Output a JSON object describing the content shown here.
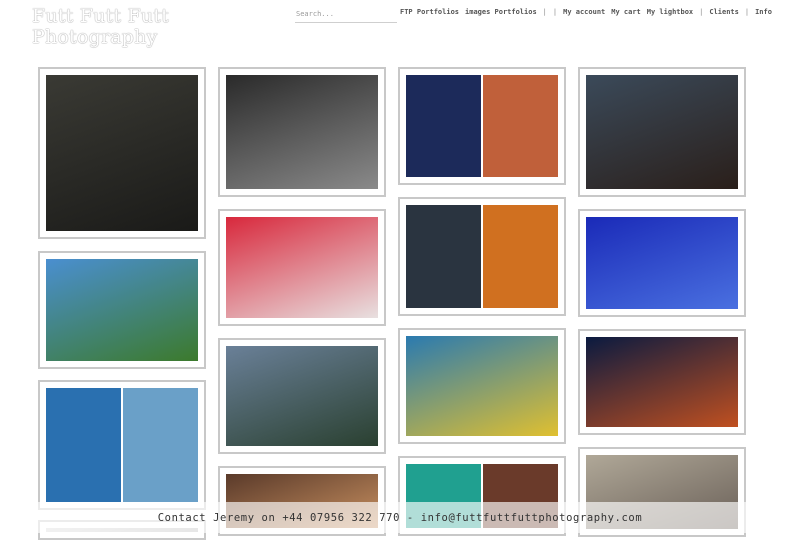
{
  "site": {
    "logo_line1": "Futt Futt Futt",
    "logo_line2": "Photography"
  },
  "search": {
    "placeholder": "Search..."
  },
  "nav": {
    "ftp_portfolios": "FTP Portfolios",
    "images_portfolios": "images Portfolios",
    "sep1": "|",
    "sep2": "|",
    "my_account": "My account",
    "my_cart": "My cart",
    "my_lightbox": "My lightbox",
    "sep3": "|",
    "clients": "Clients",
    "sep4": "|",
    "info": "Info"
  },
  "footer": {
    "contact": "Contact Jeremy on +44 07956 322 770 - info@futtfuttfuttphotography.com"
  },
  "gallery": [
    {
      "name": "photo-masks-in-forest",
      "colors": [
        "#3a3a34",
        "#1a1a18"
      ]
    },
    {
      "name": "photo-studio-interior",
      "colors": [
        "#2a2a2a",
        "#8a8a8a"
      ]
    },
    {
      "name": "photo-redhead-model",
      "colors": [
        "#1c2a5a",
        "#c0603a"
      ]
    },
    {
      "name": "photo-workshop-figure",
      "colors": [
        "#3b4a5a",
        "#2a1f1a"
      ]
    },
    {
      "name": "photo-bmx-jump",
      "colors": [
        "#4a8fd0",
        "#3c7a2c"
      ]
    },
    {
      "name": "photo-boom-mural",
      "colors": [
        "#d8283c",
        "#e8e0e0"
      ]
    },
    {
      "name": "photo-volcano-campfire",
      "colors": [
        "#2a3440",
        "#d07020"
      ]
    },
    {
      "name": "photo-stage-dancer",
      "colors": [
        "#1a2ab8",
        "#4a70e0"
      ]
    },
    {
      "name": "photo-dress-and-tower",
      "colors": [
        "#2a70b0",
        "#6aa0c8"
      ]
    },
    {
      "name": "photo-lake-jump",
      "colors": [
        "#6a8098",
        "#2a4030"
      ]
    },
    {
      "name": "photo-boat-lake",
      "colors": [
        "#2a7ab0",
        "#e0c030"
      ]
    },
    {
      "name": "photo-night-couple",
      "colors": [
        "#0a1a40",
        "#c05020"
      ]
    },
    {
      "name": "photo-doorway-man",
      "colors": [
        "#5a3a2a",
        "#c89060"
      ]
    },
    {
      "name": "photo-two-faces",
      "colors": [
        "#20a090",
        "#6a3a2a"
      ]
    },
    {
      "name": "photo-old-man-cap",
      "colors": [
        "#b0a898",
        "#6a6058"
      ]
    },
    {
      "name": "photo-bottom-left",
      "colors": [
        "#d8d8d8",
        "#b8b8b8"
      ]
    }
  ]
}
